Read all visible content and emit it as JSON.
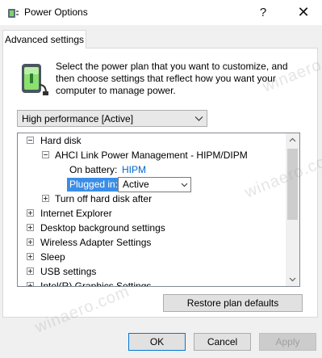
{
  "window": {
    "title": "Power Options",
    "help_glyph": "?",
    "close_glyph": "✕"
  },
  "tab": {
    "label": "Advanced settings"
  },
  "description": "Select the power plan that you want to customize, and then choose settings that reflect how you want your computer to manage power.",
  "plan_select": {
    "value": "High performance [Active]"
  },
  "tree": {
    "hard_disk": "Hard disk",
    "ahci": "AHCI Link Power Management - HIPM/DIPM",
    "on_battery_label": "On battery:",
    "on_battery_value": "HIPM",
    "plugged_in_label": "Plugged in:",
    "plugged_in_value": "Active",
    "turn_off": "Turn off hard disk after",
    "items": [
      "Internet Explorer",
      "Desktop background settings",
      "Wireless Adapter Settings",
      "Sleep",
      "USB settings",
      "Intel(R) Graphics Settings"
    ]
  },
  "buttons": {
    "restore": "Restore plan defaults",
    "ok": "OK",
    "cancel": "Cancel",
    "apply": "Apply"
  },
  "watermark": "winaero.com",
  "icons": {
    "app": "power-options-icon",
    "plan": "battery-plug-icon"
  }
}
